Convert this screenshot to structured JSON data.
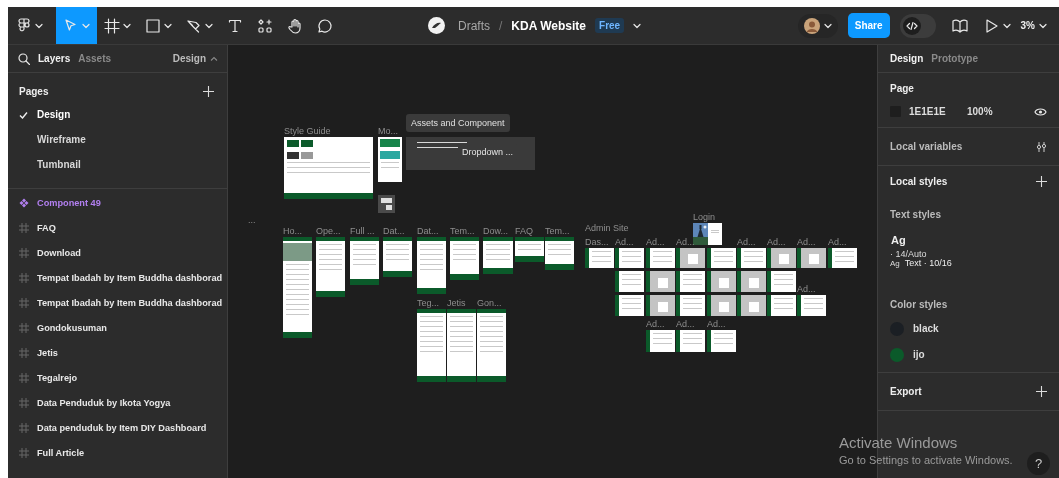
{
  "toolbar": {
    "tools": [
      {
        "kind": "main-menu",
        "selected": false
      },
      {
        "kind": "move",
        "selected": true
      },
      {
        "kind": "frame",
        "selected": false
      },
      {
        "kind": "shape",
        "selected": false
      },
      {
        "kind": "pen",
        "selected": false
      },
      {
        "kind": "text",
        "selected": false
      },
      {
        "kind": "resources",
        "selected": false
      },
      {
        "kind": "hand",
        "selected": false
      },
      {
        "kind": "comment",
        "selected": false
      }
    ],
    "breadcrumb": {
      "folder": "Drafts",
      "separator": "/",
      "file": "KDA Website",
      "plan": "Free"
    },
    "share_button": "Share",
    "dev_mode": {
      "on": false
    },
    "zoom": "3%"
  },
  "left_panel": {
    "tabs": [
      {
        "label": "Layers",
        "selected": true
      },
      {
        "label": "Assets",
        "selected": false
      }
    ],
    "page_switcher": "Design",
    "pages_heading": "Pages",
    "pages": [
      {
        "label": "Design",
        "selected": true
      },
      {
        "label": "Wireframe",
        "selected": false
      },
      {
        "label": "Tumbnail",
        "selected": false
      }
    ],
    "layers": [
      {
        "kind": "component",
        "label": "Component 49"
      },
      {
        "kind": "frame",
        "label": "FAQ"
      },
      {
        "kind": "frame",
        "label": "Download"
      },
      {
        "kind": "frame",
        "label": "Tempat Ibadah by Item Buddha dashborad"
      },
      {
        "kind": "frame",
        "label": "Tempat Ibadah by Item Buddha dashborad"
      },
      {
        "kind": "frame",
        "label": "Gondokusuman"
      },
      {
        "kind": "frame",
        "label": "Jetis"
      },
      {
        "kind": "frame",
        "label": "Tegalrejo"
      },
      {
        "kind": "frame",
        "label": "Data Penduduk by Ikota Yogya"
      },
      {
        "kind": "frame",
        "label": "Data penduduk by Item DIY Dashboard"
      },
      {
        "kind": "frame",
        "label": "Full Article"
      }
    ]
  },
  "canvas": {
    "items": [
      {
        "kind": "style-guide",
        "label": "Style Guide"
      },
      {
        "kind": "mobile",
        "label": "Mo..."
      },
      {
        "kind": "component-set",
        "label": "Assets and Component",
        "inner_label": "Dropdown ..."
      },
      {
        "kind": "icon"
      },
      {
        "kind": "text",
        "label": "..."
      },
      {
        "kind": "hero",
        "label": "Ho..."
      },
      {
        "kind": "page",
        "label": "Ope..."
      },
      {
        "kind": "page",
        "label": "Full ..."
      },
      {
        "kind": "page",
        "label": "Dat..."
      },
      {
        "kind": "page",
        "label": "Dat..."
      },
      {
        "kind": "page",
        "label": "Tem..."
      },
      {
        "kind": "page",
        "label": "Dow..."
      },
      {
        "kind": "page",
        "label": "FAQ"
      },
      {
        "kind": "page",
        "label": "Tem..."
      },
      {
        "kind": "text",
        "label": "Admin Site"
      },
      {
        "kind": "login",
        "label": "Login"
      },
      {
        "kind": "dashboard",
        "label": "Das..."
      },
      {
        "kind": "admin",
        "label": "Ad..."
      },
      {
        "kind": "admin",
        "label": "Ad..."
      },
      {
        "kind": "admin-modal",
        "label": "Ad..."
      },
      {
        "kind": "admin"
      },
      {
        "kind": "admin",
        "label": "Ad..."
      },
      {
        "kind": "admin-modal",
        "label": "Ad..."
      },
      {
        "kind": "admin-modal",
        "label": "Ad..."
      },
      {
        "kind": "admin",
        "label": "Ad..."
      },
      {
        "kind": "page",
        "label": "Teg..."
      },
      {
        "kind": "page",
        "label": "Jetis"
      },
      {
        "kind": "page",
        "label": "Gon..."
      },
      {
        "kind": "admin"
      },
      {
        "kind": "admin-modal"
      },
      {
        "kind": "admin"
      },
      {
        "kind": "admin-modal"
      },
      {
        "kind": "admin-modal"
      },
      {
        "kind": "admin"
      },
      {
        "kind": "admin"
      },
      {
        "kind": "admin-modal"
      },
      {
        "kind": "admin"
      },
      {
        "kind": "admin-modal"
      },
      {
        "kind": "admin-modal"
      },
      {
        "kind": "admin"
      },
      {
        "kind": "admin",
        "label": "Ad..."
      },
      {
        "kind": "admin",
        "label": "Ad..."
      },
      {
        "kind": "admin",
        "label": "Ad..."
      },
      {
        "kind": "admin",
        "label": "Ad..."
      }
    ]
  },
  "right_panel": {
    "tabs": [
      {
        "label": "Design",
        "selected": true
      },
      {
        "label": "Prototype",
        "selected": false
      }
    ],
    "page": {
      "heading": "Page",
      "color": "#1e1e1e",
      "hex": "1E1E1E",
      "opacity": "100%"
    },
    "local_variables": "Local variables",
    "local_styles": {
      "heading": "Local styles",
      "text_heading": "Text styles",
      "text_styles": [
        {
          "kind": "large",
          "preview": "Ag",
          "detail": "· 14/Auto"
        },
        {
          "kind": "small",
          "preview": "Ag",
          "detail": "Text · 10/16"
        }
      ],
      "color_heading": "Color styles",
      "color_styles": [
        {
          "name": "black",
          "color": "#1b1f24"
        },
        {
          "name": "ijo",
          "color": "#0b5a2a"
        }
      ]
    },
    "export": "Export"
  },
  "system_notice": {
    "title": "Activate Windows",
    "message": "Go to Settings to activate Windows."
  },
  "help_button": "?"
}
